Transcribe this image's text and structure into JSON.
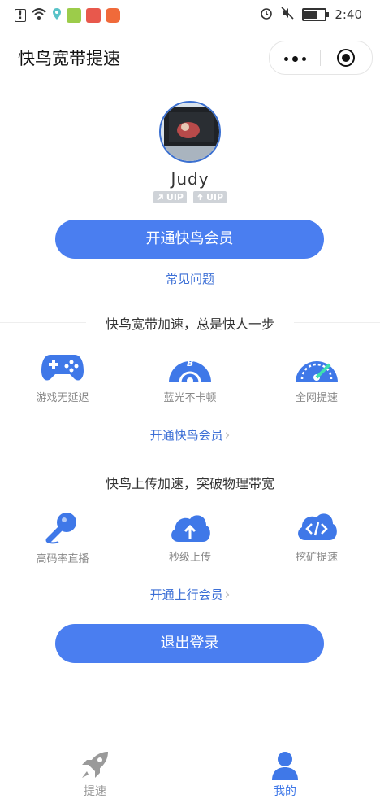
{
  "status_bar": {
    "time": "2:40",
    "left_icons": [
      "alert-icon",
      "wifi-icon",
      "location-icon",
      "app-icon-green",
      "app-icon-red",
      "app-icon-orange"
    ],
    "right_icons": [
      "alarm-icon",
      "mute-icon",
      "battery-icon"
    ]
  },
  "header": {
    "title": "快鸟宽带提速"
  },
  "profile": {
    "username": "Judy",
    "badges": [
      {
        "label": "UIP"
      },
      {
        "label": "UIP"
      }
    ]
  },
  "main": {
    "open_member_button": "开通快鸟会员",
    "faq_link": "常见问题",
    "download_section": {
      "title": "快鸟宽带加速，总是快人一步",
      "features": [
        {
          "label": "游戏无延迟",
          "icon": "gamepad-icon"
        },
        {
          "label": "蓝光不卡顿",
          "icon": "bluray-disc-icon"
        },
        {
          "label": "全网提速",
          "icon": "speedometer-icon"
        }
      ],
      "link": "开通快鸟会员"
    },
    "upload_section": {
      "title": "快鸟上传加速，突破物理带宽",
      "features": [
        {
          "label": "高码率直播",
          "icon": "microphone-icon"
        },
        {
          "label": "秒级上传",
          "icon": "cloud-upload-icon"
        },
        {
          "label": "挖矿提速",
          "icon": "cloud-code-icon"
        }
      ],
      "link": "开通上行会员"
    },
    "logout_button": "退出登录"
  },
  "tabbar": {
    "tabs": [
      {
        "label": "提速",
        "icon": "rocket-icon",
        "active": false
      },
      {
        "label": "我的",
        "icon": "user-icon",
        "active": true
      }
    ]
  },
  "colors": {
    "accent": "#4a7ef0",
    "link": "#3c6fd6",
    "inactive": "#9a9a9a"
  }
}
